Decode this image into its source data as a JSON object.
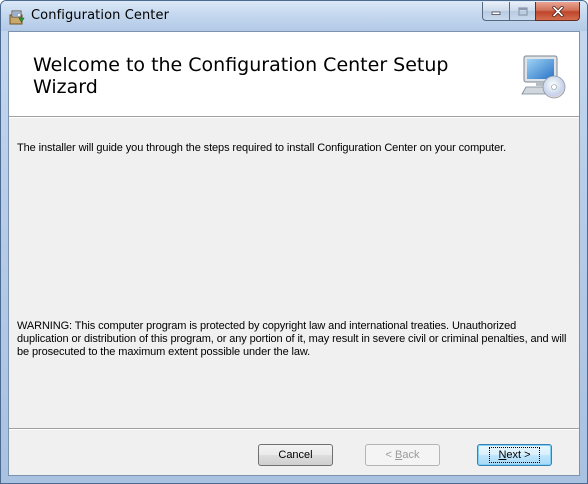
{
  "window": {
    "title": "Configuration Center"
  },
  "banner": {
    "title": "Welcome to the Configuration Center Setup Wizard"
  },
  "content": {
    "intro": "The installer will guide you through the steps required to install Configuration Center on your computer.",
    "warning": "WARNING: This computer program is protected by copyright law and international treaties. Unauthorized duplication or distribution of this program, or any portion of it, may result in severe civil or criminal penalties, and will be prosecuted to the maximum extent possible under the law."
  },
  "buttons": {
    "cancel": "Cancel",
    "back_prefix": "< ",
    "back_mnemonic": "B",
    "back_rest": "ack",
    "next_mnemonic": "N",
    "next_rest": "ext >",
    "back_enabled": false,
    "next_is_default": true
  },
  "icons": {
    "app": "installer-package-icon",
    "banner": "computer-cd-icon",
    "minimize": "minimize-icon",
    "maximize": "maximize-icon",
    "close": "close-icon"
  },
  "colors": {
    "close_button": "#c0452b",
    "client_background": "#f0f0f0",
    "default_button_border": "#3c7fb1"
  }
}
